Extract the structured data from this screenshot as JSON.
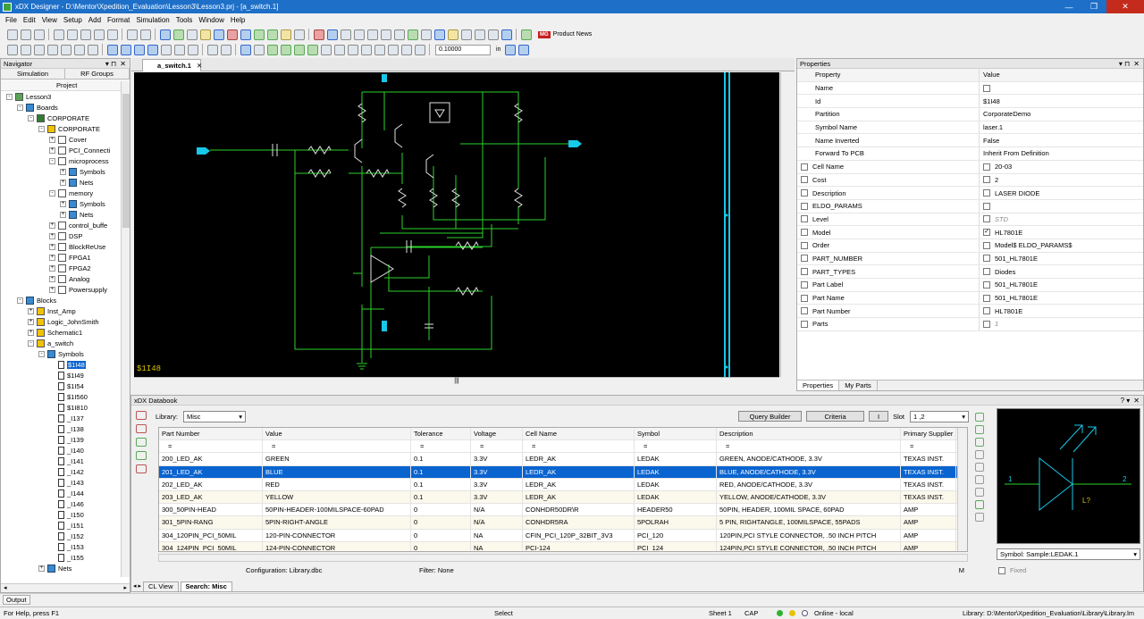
{
  "window": {
    "title": "xDX Designer - D:\\Mentor\\Xpedition_Evaluation\\Lesson3\\Lesson3.prj - [a_switch.1]",
    "min": "—",
    "max": "❐",
    "close": "✕"
  },
  "menu": [
    "File",
    "Edit",
    "View",
    "Setup",
    "Add",
    "Format",
    "Simulation",
    "Tools",
    "Window",
    "Help"
  ],
  "toolbar": {
    "product_news": "Product News",
    "zoom_value": "0.10000",
    "zoom_unit": "in"
  },
  "navigator": {
    "title": "Navigator",
    "tabs": [
      "Simulation",
      "RF Groups"
    ],
    "project_label": "Project",
    "tree": [
      {
        "label": "Lesson3",
        "level": 0,
        "icon": "proj",
        "exp": "-"
      },
      {
        "label": "Boards",
        "level": 1,
        "icon": "folder",
        "exp": "-"
      },
      {
        "label": "CORPORATE",
        "level": 2,
        "icon": "corp",
        "exp": "-"
      },
      {
        "label": "CORPORATE",
        "level": 3,
        "icon": "blk",
        "exp": "-"
      },
      {
        "label": "Cover",
        "level": 4,
        "icon": "doc",
        "exp": "+"
      },
      {
        "label": "PCI_Connecti",
        "level": 4,
        "icon": "doc",
        "exp": "+"
      },
      {
        "label": "microprocess",
        "level": 4,
        "icon": "doc",
        "exp": "-"
      },
      {
        "label": "Symbols",
        "level": 5,
        "icon": "folder",
        "exp": "+"
      },
      {
        "label": "Nets",
        "level": 5,
        "icon": "folder",
        "exp": "+"
      },
      {
        "label": "memory",
        "level": 4,
        "icon": "doc",
        "exp": "-"
      },
      {
        "label": "Symbols",
        "level": 5,
        "icon": "folder",
        "exp": "+"
      },
      {
        "label": "Nets",
        "level": 5,
        "icon": "folder",
        "exp": "+"
      },
      {
        "label": "control_buffe",
        "level": 4,
        "icon": "doc",
        "exp": "+"
      },
      {
        "label": "DSP",
        "level": 4,
        "icon": "doc",
        "exp": "+"
      },
      {
        "label": "BlockReUse",
        "level": 4,
        "icon": "doc",
        "exp": "+"
      },
      {
        "label": "FPGA1",
        "level": 4,
        "icon": "doc",
        "exp": "+"
      },
      {
        "label": "FPGA2",
        "level": 4,
        "icon": "doc",
        "exp": "+"
      },
      {
        "label": "Analog",
        "level": 4,
        "icon": "doc",
        "exp": "+"
      },
      {
        "label": "Powersupply",
        "level": 4,
        "icon": "doc",
        "exp": "+"
      },
      {
        "label": "Blocks",
        "level": 1,
        "icon": "folder",
        "exp": "-"
      },
      {
        "label": "Inst_Amp",
        "level": 2,
        "icon": "blk",
        "exp": "+"
      },
      {
        "label": "Logic_JohnSmith",
        "level": 2,
        "icon": "blk",
        "exp": "+"
      },
      {
        "label": "Schematic1",
        "level": 2,
        "icon": "blk",
        "exp": "+"
      },
      {
        "label": "a_switch",
        "level": 2,
        "icon": "blk",
        "exp": "-"
      },
      {
        "label": "Symbols",
        "level": 3,
        "icon": "folder",
        "exp": "-"
      },
      {
        "label": "$1I48",
        "level": 4,
        "icon": "sym",
        "exp": "",
        "sel": true
      },
      {
        "label": "$1I49",
        "level": 4,
        "icon": "sym",
        "exp": ""
      },
      {
        "label": "$1I54",
        "level": 4,
        "icon": "sym",
        "exp": ""
      },
      {
        "label": "$1I560",
        "level": 4,
        "icon": "sym",
        "exp": ""
      },
      {
        "label": "$1I810",
        "level": 4,
        "icon": "sym",
        "exp": ""
      },
      {
        "label": "_I137",
        "level": 4,
        "icon": "sym",
        "exp": ""
      },
      {
        "label": "_I138",
        "level": 4,
        "icon": "sym",
        "exp": ""
      },
      {
        "label": "_I139",
        "level": 4,
        "icon": "sym",
        "exp": ""
      },
      {
        "label": "_I140",
        "level": 4,
        "icon": "sym",
        "exp": ""
      },
      {
        "label": "_I141",
        "level": 4,
        "icon": "sym",
        "exp": ""
      },
      {
        "label": "_I142",
        "level": 4,
        "icon": "sym",
        "exp": ""
      },
      {
        "label": "_I143",
        "level": 4,
        "icon": "sym",
        "exp": ""
      },
      {
        "label": "_I144",
        "level": 4,
        "icon": "sym",
        "exp": ""
      },
      {
        "label": "_I146",
        "level": 4,
        "icon": "sym",
        "exp": ""
      },
      {
        "label": "_I150",
        "level": 4,
        "icon": "sym",
        "exp": ""
      },
      {
        "label": "_I151",
        "level": 4,
        "icon": "sym",
        "exp": ""
      },
      {
        "label": "_I152",
        "level": 4,
        "icon": "sym",
        "exp": ""
      },
      {
        "label": "_I153",
        "level": 4,
        "icon": "sym",
        "exp": ""
      },
      {
        "label": "_I155",
        "level": 4,
        "icon": "sym",
        "exp": ""
      },
      {
        "label": "Nets",
        "level": 3,
        "icon": "folder",
        "exp": "+"
      }
    ]
  },
  "doc_tab": "a_switch.1",
  "canvas": {
    "selected_label": "$1I48",
    "bg": "#000000",
    "wire": "#2bd22b",
    "net": "#18c8e8",
    "part": "#e0e0e0"
  },
  "properties": {
    "title": "Properties",
    "col_property": "Property",
    "col_value": "Value",
    "rows": [
      {
        "name": "Name",
        "value": "",
        "cb": false,
        "vcb": "empty"
      },
      {
        "name": "Id",
        "value": "$1I48",
        "cb": false
      },
      {
        "name": "Partition",
        "value": "CorporateDemo",
        "cb": false
      },
      {
        "name": "Symbol Name",
        "value": "laser.1",
        "cb": false
      },
      {
        "name": "Name Inverted",
        "value": "False",
        "cb": false
      },
      {
        "name": "Forward To PCB",
        "value": "Inherit From Definition",
        "cb": false
      },
      {
        "name": "Cell Name",
        "value": "20-03",
        "cb": true,
        "vcb": "empty"
      },
      {
        "name": "Cost",
        "value": "2",
        "cb": true,
        "vcb": "empty"
      },
      {
        "name": "Description",
        "value": "LASER DIODE",
        "cb": true,
        "vcb": "empty"
      },
      {
        "name": "ELDO_PARAMS",
        "value": "",
        "cb": true,
        "vcb": "empty"
      },
      {
        "name": "Level",
        "value": "STD",
        "cb": true,
        "vcb": "empty",
        "italic": true
      },
      {
        "name": "Model",
        "value": "HL7801E",
        "cb": true,
        "vcb": "checked"
      },
      {
        "name": "Order",
        "value": "Model$ ELDO_PARAMS$",
        "cb": true,
        "vcb": "empty"
      },
      {
        "name": "PART_NUMBER",
        "value": "501_HL7801E",
        "cb": true,
        "vcb": "empty"
      },
      {
        "name": "PART_TYPES",
        "value": "Diodes",
        "cb": true,
        "vcb": "empty"
      },
      {
        "name": "Part Label",
        "value": "501_HL7801E",
        "cb": true,
        "vcb": "empty"
      },
      {
        "name": "Part Name",
        "value": "501_HL7801E",
        "cb": true,
        "vcb": "empty"
      },
      {
        "name": "Part Number",
        "value": "HL7801E",
        "cb": true,
        "vcb": "empty"
      },
      {
        "name": "Parts",
        "value": "1",
        "cb": true,
        "vcb": "empty",
        "italic": true
      }
    ],
    "tabs": [
      "Properties",
      "My Parts"
    ]
  },
  "databook": {
    "title": "xDX Databook",
    "library_label": "Library:",
    "library_value": "Misc",
    "query_builder": "Query Builder",
    "criteria": "Criteria",
    "pipe": "I",
    "slot_label": "Slot",
    "slot_value": "1 ,2",
    "columns": [
      "Part Number",
      "Value",
      "Tolerance",
      "Voltage",
      "Cell Name",
      "Symbol",
      "Description",
      "Primary Supplier"
    ],
    "filter_row": [
      "=",
      "=",
      "=",
      "=",
      "=",
      "=",
      "=",
      "="
    ],
    "rows": [
      [
        "200_LED_AK",
        "GREEN",
        "0.1",
        "3.3V",
        "LEDR_AK",
        "LEDAK",
        "GREEN, ANODE/CATHODE, 3.3V",
        "TEXAS INST."
      ],
      [
        "201_LED_AK",
        "BLUE",
        "0.1",
        "3.3V",
        "LEDR_AK",
        "LEDAK",
        "BLUE, ANODE/CATHODE, 3.3V",
        "TEXAS INST."
      ],
      [
        "202_LED_AK",
        "RED",
        "0.1",
        "3.3V",
        "LEDR_AK",
        "LEDAK",
        "RED, ANODE/CATHODE, 3.3V",
        "TEXAS INST."
      ],
      [
        "203_LED_AK",
        "YELLOW",
        "0.1",
        "3.3V",
        "LEDR_AK",
        "LEDAK",
        "YELLOW, ANODE/CATHODE, 3.3V",
        "TEXAS INST."
      ],
      [
        "300_50PIN-HEAD",
        "50PIN-HEADER-100MILSPACE-60PAD",
        "0",
        "N/A",
        "CONHDR50DR\\R",
        "HEADER50",
        "50PIN, HEADER, 100MIL SPACE, 60PAD",
        "AMP"
      ],
      [
        "301_5PIN-RANG",
        "5PIN-RIGHT-ANGLE",
        "0",
        "N/A",
        "CONHDR5RA",
        "5POLRAH",
        "5 PIN, RIGHTANGLE, 100MILSPACE, 55PADS",
        "AMP"
      ],
      [
        "304_120PIN_PCI_50MIL",
        "120-PIN-CONNECTOR",
        "0",
        "NA",
        "CFIN_PCI_120P_32BIT_3V3",
        "PCI_120",
        "120PIN,PCI STYLE CONNECTOR, .50 INCH PITCH",
        "AMP"
      ],
      [
        "304_124PIN_PCI_50MIL",
        "124-PIN-CONNECTOR",
        "0",
        "NA",
        "PCI-124",
        "PCI_124",
        "124PIN,PCI STYLE CONNECTOR, .50 INCH PITCH",
        "AMP"
      ]
    ],
    "selected_row": 1,
    "config": "Configuration: Library.dbc",
    "filter": "Filter: None",
    "m": "M",
    "symbol_select": "Symbol: Sample:LEDAK.1",
    "fixed": "Fixed",
    "preview": {
      "pin1": "1",
      "pin2": "2",
      "ref": "L?"
    },
    "tabs": [
      "CL View",
      "Search: Misc"
    ]
  },
  "output_tab": "Output",
  "status": {
    "help": "For Help, press F1",
    "mode": "Select",
    "sheet": "Sheet 1",
    "cap": "CAP",
    "online": "Online - local",
    "library": "Library: D:\\Mentor\\Xpedition_Evaluation\\Library\\Library.lm"
  }
}
